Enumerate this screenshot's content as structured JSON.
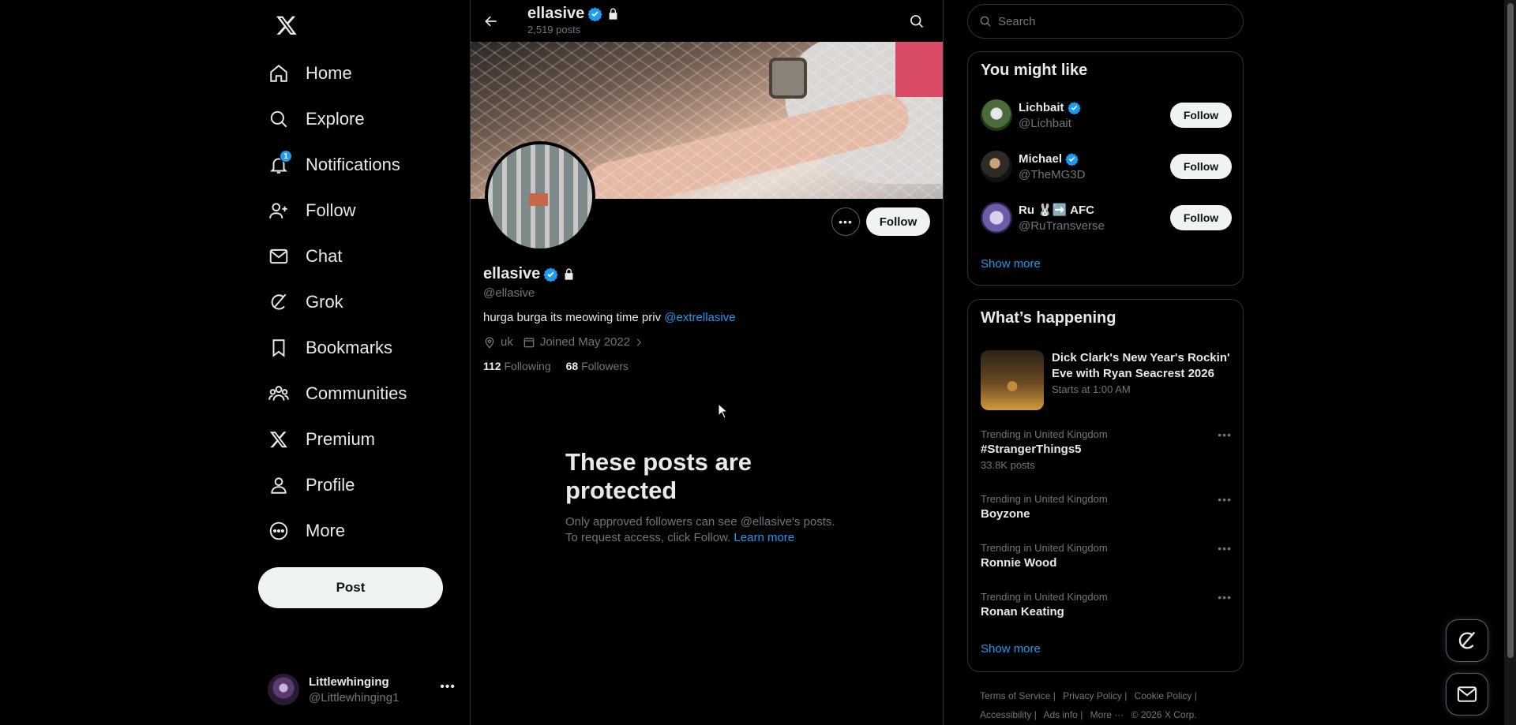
{
  "sidebar": {
    "nav": [
      {
        "label": "Home",
        "icon": "home-icon"
      },
      {
        "label": "Explore",
        "icon": "search-icon"
      },
      {
        "label": "Notifications",
        "icon": "bell-icon",
        "badge": "1"
      },
      {
        "label": "Follow",
        "icon": "add-person-icon"
      },
      {
        "label": "Chat",
        "icon": "envelope-icon"
      },
      {
        "label": "Grok",
        "icon": "grok-icon"
      },
      {
        "label": "Bookmarks",
        "icon": "bookmark-icon"
      },
      {
        "label": "Communities",
        "icon": "people-icon"
      },
      {
        "label": "Premium",
        "icon": "x-logo-icon"
      },
      {
        "label": "Profile",
        "icon": "person-icon"
      },
      {
        "label": "More",
        "icon": "more-circle-icon"
      }
    ],
    "post_label": "Post",
    "account": {
      "name": "Littlewhinging",
      "handle": "@Littlewhinging1"
    }
  },
  "header": {
    "name": "ellasive",
    "posts": "2,519 posts"
  },
  "profile": {
    "name": "ellasive",
    "handle": "@ellasive",
    "bio_text": "hurga burga its meowing time priv ",
    "bio_link": "@extrellasive",
    "location": "uk",
    "joined": "Joined May 2022",
    "following_count": "112",
    "following_label": "Following",
    "followers_count": "68",
    "followers_label": "Followers",
    "follow_label": "Follow"
  },
  "protected": {
    "title": "These posts are protected",
    "line1": "Only approved followers can see @ellasive's posts.",
    "line2": "To request access, click Follow. ",
    "learn_more": "Learn more"
  },
  "right": {
    "search_placeholder": "Search",
    "wtf_title": "You might like",
    "suggestions": [
      {
        "name": "Lichbait",
        "handle": "@Lichbait",
        "follow": "Follow",
        "verified": true
      },
      {
        "name": "Michael",
        "handle": "@TheMG3D",
        "follow": "Follow",
        "verified": true
      },
      {
        "name": "Ru 🐰➡️ AFC",
        "handle": "@RuTransverse",
        "follow": "Follow",
        "verified": false
      }
    ],
    "show_more": "Show more",
    "trends_title": "What’s happening",
    "news": {
      "title": "Dick Clark's New Year's Rockin' Eve with Ryan Seacrest 2026",
      "sub": "Starts at 1:00 AM"
    },
    "trends": [
      {
        "context": "Trending in United Kingdom",
        "name": "#StrangerThings5",
        "count": "33.8K posts"
      },
      {
        "context": "Trending in United Kingdom",
        "name": "Boyzone",
        "count": ""
      },
      {
        "context": "Trending in United Kingdom",
        "name": "Ronnie Wood",
        "count": ""
      },
      {
        "context": "Trending in United Kingdom",
        "name": "Ronan Keating",
        "count": ""
      }
    ],
    "trends_show_more": "Show more"
  },
  "footer": {
    "links": [
      "Terms of Service",
      "Privacy Policy",
      "Cookie Policy",
      "Accessibility",
      "Ads info",
      "More ···",
      "© 2026 X Corp."
    ]
  },
  "colors": {
    "accent": "#1d9bf0",
    "background": "#000000",
    "text": "#e7e9ea",
    "muted": "#71767b",
    "border": "#2f3336"
  }
}
